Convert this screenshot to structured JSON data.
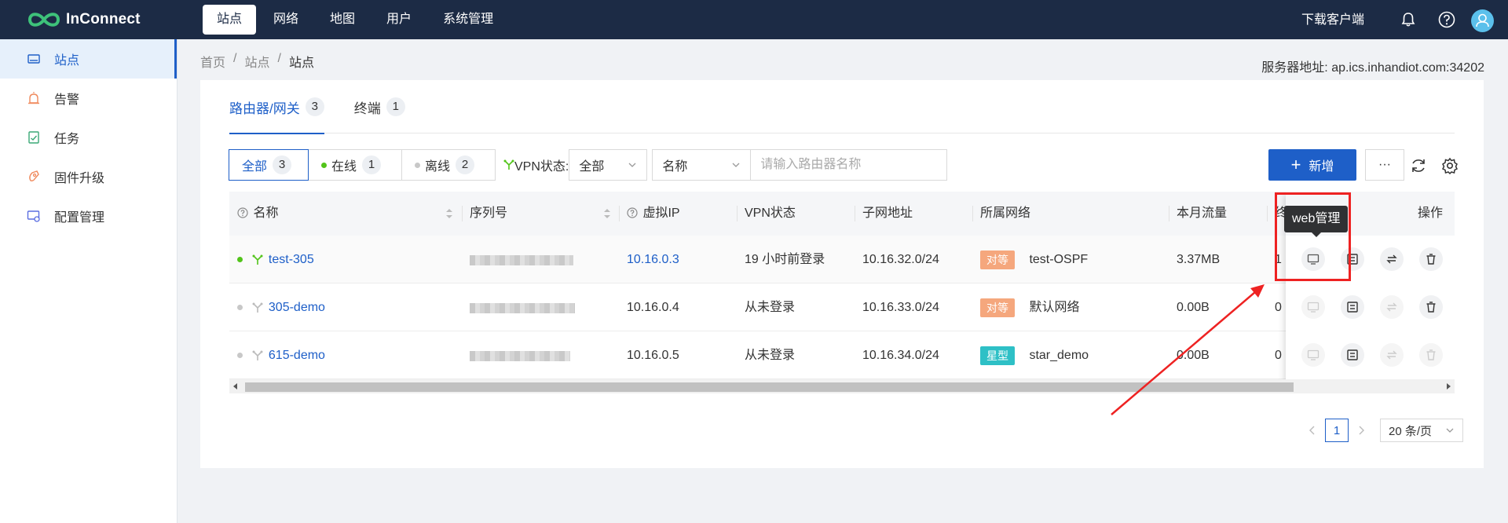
{
  "topbar": {
    "logo_text": "InConnect",
    "nav": [
      "站点",
      "网络",
      "地图",
      "用户",
      "系统管理"
    ],
    "active_nav": 0,
    "download_label": "下载客户端",
    "accent": "#1e5fc8",
    "bg": "#1c2b45"
  },
  "sidebar": {
    "items": [
      {
        "label": "站点",
        "icon": "site-icon"
      },
      {
        "label": "告警",
        "icon": "alarm-icon"
      },
      {
        "label": "任务",
        "icon": "task-icon"
      },
      {
        "label": "固件升级",
        "icon": "firmware-icon"
      },
      {
        "label": "配置管理",
        "icon": "config-icon"
      }
    ],
    "active": 0
  },
  "breadcrumb": [
    "首页",
    "/",
    "站点",
    "/",
    "站点"
  ],
  "server": "服务器地址: ap.ics.inhandiot.com:34202",
  "tabs": [
    {
      "label": "路由器/网关",
      "count": "3"
    },
    {
      "label": "终端",
      "count": "1"
    }
  ],
  "filters": {
    "segments": [
      {
        "label": "全部",
        "count": "3"
      },
      {
        "label": "在线",
        "count": "1",
        "dot": "#52c41a"
      },
      {
        "label": "离线",
        "count": "2",
        "dot": "#c8c8c8"
      }
    ],
    "vpn_label": "VPN状态:",
    "vpn_value": "全部",
    "field_value": "名称",
    "search_placeholder": "请输入路由器名称",
    "add_label": "新增",
    "more_label": "···"
  },
  "table": {
    "columns": [
      "名称",
      "序列号",
      "虚拟IP",
      "VPN状态",
      "子网地址",
      "所属网络",
      "本月流量",
      "终",
      "操作"
    ],
    "rows": [
      {
        "name": "test-305",
        "online": true,
        "vip": "10.16.0.3",
        "vpn": "19 小时前登录",
        "subnet": "10.16.32.0/24",
        "net_tag": "对等",
        "net_tag_color": "#f5a77d",
        "network": "test-OSPF",
        "traffic": "3.37MB",
        "terminals": "1"
      },
      {
        "name": "305-demo",
        "online": false,
        "vip": "10.16.0.4",
        "vpn": "从未登录",
        "subnet": "10.16.33.0/24",
        "net_tag": "对等",
        "net_tag_color": "#f5a77d",
        "network": "默认网络",
        "traffic": "0.00B",
        "terminals": "0"
      },
      {
        "name": "615-demo",
        "online": false,
        "vip": "10.16.0.5",
        "vpn": "从未登录",
        "subnet": "10.16.34.0/24",
        "net_tag": "星型",
        "net_tag_color": "#2ec0c6",
        "network": "star_demo",
        "traffic": "0.00B",
        "terminals": "0"
      }
    ]
  },
  "pagination": {
    "page": "1",
    "page_size": "20 条/页"
  },
  "tooltip": "web管理"
}
